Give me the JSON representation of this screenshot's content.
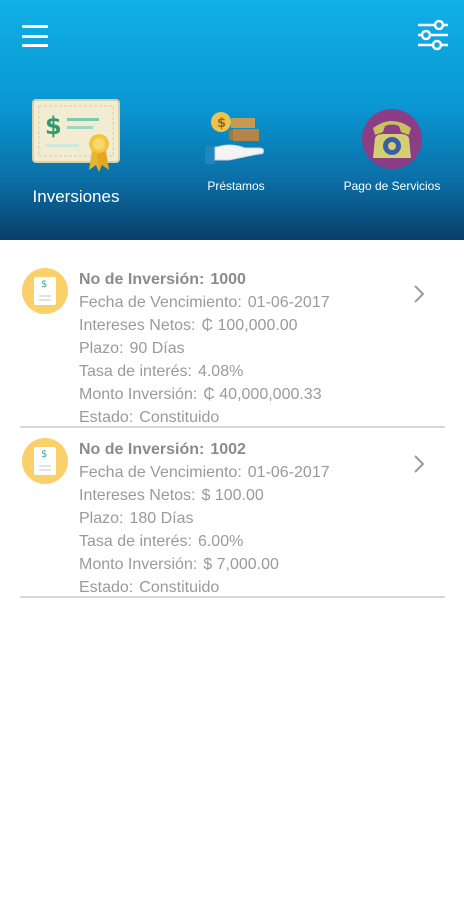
{
  "header": {
    "categories": [
      {
        "label": "Inversiones",
        "icon": "certificate-icon"
      },
      {
        "label": "Préstamos",
        "icon": "loan-hand-icon"
      },
      {
        "label": "Pago de Servicios",
        "icon": "telephone-icon"
      }
    ],
    "icons": {
      "menu": "hamburger-menu-icon",
      "filter": "settings-sliders-icon"
    }
  },
  "investments": [
    {
      "numero_label": "No de Inversión:",
      "numero": "1000",
      "vencimiento_label": "Fecha de Vencimiento:",
      "vencimiento": "01-06-2017",
      "intereses_label": "Intereses Netos:",
      "intereses": "₵ 100,000.00",
      "plazo_label": "Plazo:",
      "plazo": "90  Días",
      "tasa_label": "Tasa de interés:",
      "tasa": "4.08%",
      "monto_label": "Monto Inversión:",
      "monto": "₵ 40,000,000.33",
      "estado_label": "Estado:",
      "estado": "Constituido"
    },
    {
      "numero_label": "No de Inversión:",
      "numero": "1002",
      "vencimiento_label": "Fecha de Vencimiento:",
      "vencimiento": "01-06-2017",
      "intereses_label": "Intereses Netos:",
      "intereses": "$ 100.00",
      "plazo_label": "Plazo:",
      "plazo": "180  Días",
      "tasa_label": "Tasa de interés:",
      "tasa": "6.00%",
      "monto_label": "Monto Inversión:",
      "monto": "$ 7,000.00",
      "estado_label": "Estado:",
      "estado": "Constituido"
    }
  ],
  "colors": {
    "header_top": "#10b0e8",
    "header_bottom": "#0a3e6a",
    "icon_bg": "#f9d06a",
    "text": "#9a9a9a"
  }
}
